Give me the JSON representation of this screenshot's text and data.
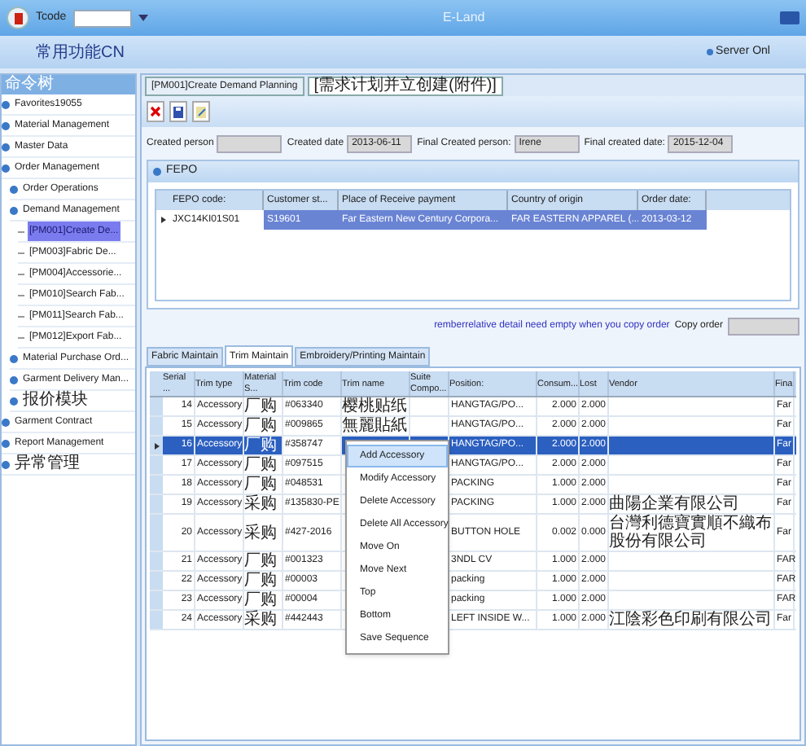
{
  "window": {
    "title": "E-Land",
    "tcode_label": "Tcode",
    "menu_label": "常用功能CN",
    "server_status": "Server Onl"
  },
  "sidebar": {
    "title": "命令树",
    "items": [
      {
        "label": "Favorites19055",
        "selected": false
      },
      {
        "label": "Material Management",
        "selected": false
      },
      {
        "label": "Master Data",
        "selected": false
      },
      {
        "label": "Order Management",
        "selected": false,
        "children": [
          {
            "label": "Order Operations",
            "selected": false
          },
          {
            "label": "Demand Management",
            "selected": false,
            "children": [
              {
                "label": "[PM001]Create De...",
                "selected": true
              },
              {
                "label": "[PM003]Fabric De...",
                "selected": false
              },
              {
                "label": "[PM004]Accessorie...",
                "selected": false
              },
              {
                "label": "[PM010]Search Fab...",
                "selected": false
              },
              {
                "label": "[PM011]Search Fab...",
                "selected": false
              },
              {
                "label": "[PM012]Export Fab...",
                "selected": false
              }
            ]
          },
          {
            "label": "Material Purchase Ord...",
            "selected": false
          },
          {
            "label": "Garment Delivery Man...",
            "selected": false
          },
          {
            "label": "报价模块",
            "selected": false
          }
        ]
      },
      {
        "label": "Garment Contract",
        "selected": false
      },
      {
        "label": "Report Management",
        "selected": false
      },
      {
        "label": "异常管理",
        "selected": false
      }
    ]
  },
  "doc_tabs": [
    {
      "label": "[PM001]Create Demand Planning",
      "selected": false
    },
    {
      "label": "[需求计划并立创建(附件)]",
      "selected": true
    }
  ],
  "form": [
    {
      "label": "Created person"
    },
    {
      "label": "Created date",
      "value": "2013-06-11"
    },
    {
      "label": "Final Created person:",
      "value": "Irene"
    },
    {
      "label": "Final created date:",
      "value": "2015-12-04"
    }
  ],
  "fepo": {
    "title": "FEPO",
    "columns": [
      "FEPO code:",
      "Customer st...",
      "Place of Receive payment",
      "Country of origin",
      "Order date:"
    ],
    "row": [
      "JXC14KI01S01",
      "S19601",
      "Far Eastern New Century Corpora...",
      "FAR EASTERN APPAREL (...",
      "2013-03-12"
    ]
  },
  "notice": "remberrelative detail need empty when you copy order",
  "copy_order_label": "Copy order",
  "trim_tabs": [
    {
      "label": "Fabric Maintain",
      "selected": false
    },
    {
      "label": "Trim Maintain",
      "selected": true
    },
    {
      "label": "Embroidery/Printing Maintain",
      "selected": false
    }
  ],
  "trim_columns": [
    "Serial ...",
    "Trim type",
    "Material S...",
    "Trim code",
    "Trim name",
    "Suite Compo...",
    "Position:",
    "Consum...",
    "Lost",
    "Vendor",
    "Fina"
  ],
  "trim_rows": [
    {
      "serial": "14",
      "type": "Accessory",
      "material": "厂购",
      "code": "#063340",
      "name": "樱桃贴纸",
      "position": "HANGTAG/PO...",
      "consumption": "2.000",
      "lost": "2.000",
      "final": "Far",
      "selected": false
    },
    {
      "serial": "15",
      "type": "Accessory",
      "material": "厂购",
      "code": "#009865",
      "name": "無麗貼紙",
      "position": "HANGTAG/PO...",
      "consumption": "2.000",
      "lost": "2.000",
      "final": "Far",
      "selected": false
    },
    {
      "serial": "16",
      "type": "Accessory",
      "material": "厂购",
      "code": "#358747",
      "position": "HANGTAG/PO...",
      "consumption": "2.000",
      "lost": "2.000",
      "final": "Far",
      "selected": true
    },
    {
      "serial": "17",
      "type": "Accessory",
      "material": "厂购",
      "code": "#097515",
      "position": "HANGTAG/PO...",
      "consumption": "2.000",
      "lost": "2.000",
      "final": "Far",
      "selected": false
    },
    {
      "serial": "18",
      "type": "Accessory",
      "material": "厂购",
      "code": "#048531",
      "position": "PACKING",
      "consumption": "1.000",
      "lost": "2.000",
      "final": "Far",
      "selected": false
    },
    {
      "serial": "19",
      "type": "Accessory",
      "material": "采购",
      "code": "#135830-PE",
      "position": "PACKING",
      "consumption": "1.000",
      "lost": "2.000",
      "vendor": "曲陽企業有限公司",
      "final": "Far",
      "selected": false
    },
    {
      "serial": "20",
      "type": "Accessory",
      "material": "采购",
      "code": "#427-2016",
      "position": "BUTTON HOLE",
      "consumption": "0.002",
      "lost": "0.000",
      "vendor": "台灣利德寶實順不織布股份有限公司",
      "final": "Far",
      "selected": false
    },
    {
      "serial": "21",
      "type": "Accessory",
      "material": "厂购",
      "code": "#001323",
      "position": "3NDL CV",
      "consumption": "1.000",
      "lost": "2.000",
      "final": "FAR",
      "selected": false
    },
    {
      "serial": "22",
      "type": "Accessory",
      "material": "厂购",
      "code": "#00003",
      "position": "packing",
      "consumption": "1.000",
      "lost": "2.000",
      "final": "FAR",
      "selected": false
    },
    {
      "serial": "23",
      "type": "Accessory",
      "material": "厂购",
      "code": "#00004",
      "position": "packing",
      "consumption": "1.000",
      "lost": "2.000",
      "final": "FAR",
      "selected": false
    },
    {
      "serial": "24",
      "type": "Accessory",
      "material": "采购",
      "code": "#442443",
      "position": "LEFT INSIDE W...",
      "consumption": "1.000",
      "lost": "2.000",
      "vendor": "江陰彩色印刷有限公司",
      "final": "Far",
      "selected": false
    }
  ],
  "context_menu": [
    {
      "label": "Add Accessory",
      "selected": true
    },
    {
      "label": "Modify Accessory",
      "selected": false
    },
    {
      "label": "Delete Accessory",
      "selected": false
    },
    {
      "label": "Delete All Accessory",
      "selected": false
    },
    {
      "label": "Move On",
      "selected": false
    },
    {
      "label": "Move Next",
      "selected": false
    },
    {
      "label": "Top",
      "selected": false
    },
    {
      "label": "Bottom",
      "selected": false
    },
    {
      "label": "Save Sequence",
      "selected": false
    }
  ]
}
